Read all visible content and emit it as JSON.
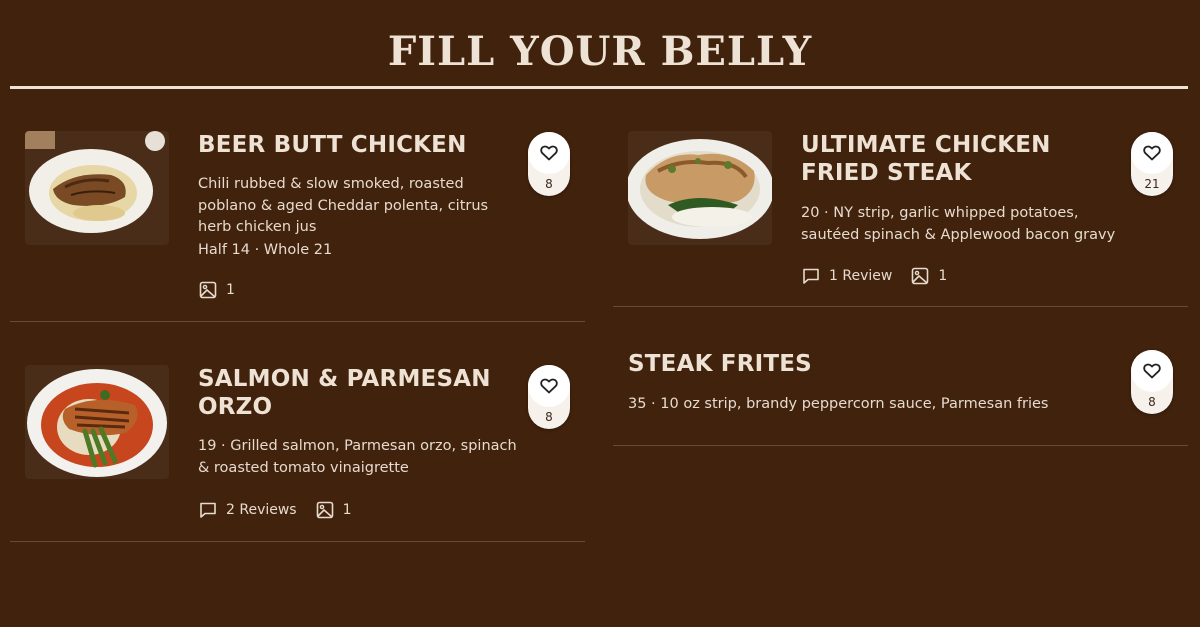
{
  "page": {
    "title": "FILL YOUR BELLY"
  },
  "items": [
    {
      "name": "BEER BUTT CHICKEN",
      "description": "Chili rubbed & slow smoked, roasted poblano & aged Cheddar polenta, citrus herb chicken jus",
      "price": "Half 14 · Whole 21",
      "likes": "8",
      "reviews": "",
      "photos": "1",
      "image_icon": "photo-icon",
      "like_icon": "heart-icon"
    },
    {
      "name": "ULTIMATE CHICKEN FRIED STEAK",
      "description": "20 · NY strip, garlic whipped potatoes, sautéed spinach & Applewood bacon gravy",
      "likes": "21",
      "reviews": "1 Review",
      "photos": "1",
      "review_icon": "comment-icon",
      "image_icon": "photo-icon",
      "like_icon": "heart-icon"
    },
    {
      "name": "SALMON & PARMESAN ORZO",
      "description": "19 · Grilled salmon, Parmesan orzo, spinach & roasted tomato vinaigrette",
      "likes": "8",
      "reviews": "2 Reviews",
      "photos": "1",
      "review_icon": "comment-icon",
      "image_icon": "photo-icon",
      "like_icon": "heart-icon"
    },
    {
      "name": "STEAK FRITES",
      "description": "35 · 10 oz strip, brandy peppercorn sauce, Parmesan fries",
      "likes": "8",
      "like_icon": "heart-icon"
    }
  ],
  "colors": {
    "background": "#41220d",
    "text": "#ede2d4",
    "divider": "#6b4a33",
    "like_button": "#ffffff"
  }
}
